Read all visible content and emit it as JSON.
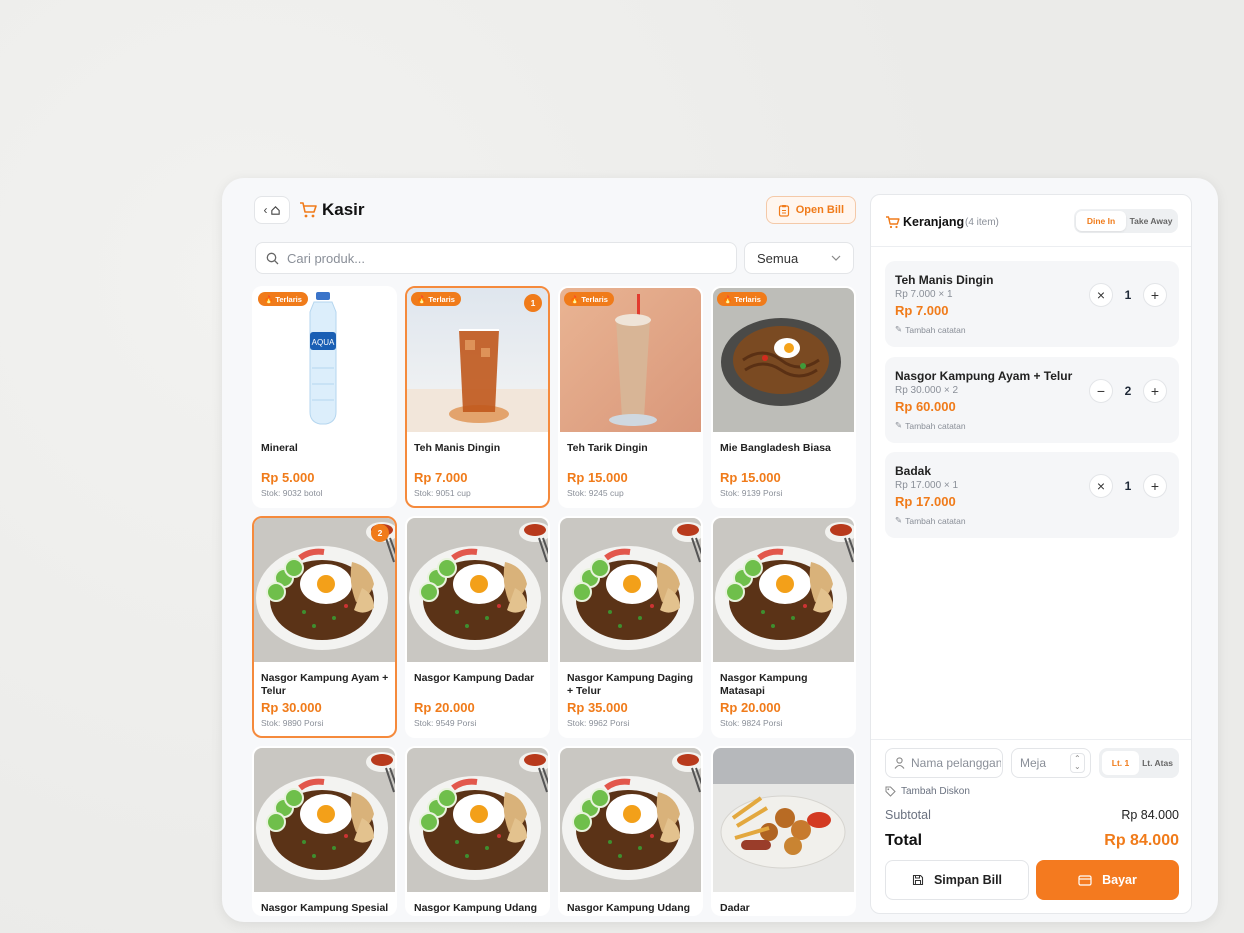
{
  "header": {
    "title": "Kasir",
    "open_bill": "Open Bill"
  },
  "search": {
    "placeholder": "Cari produk...",
    "filter_value": "Semua"
  },
  "badge_label": "Terlaris",
  "products": [
    {
      "name": "Mineral",
      "price": "Rp 5.000",
      "stock": "Stok: 9032 botol",
      "badge": true,
      "qty": "",
      "image": "water-bottle"
    },
    {
      "name": "Teh Manis Dingin",
      "price": "Rp 7.000",
      "stock": "Stok: 9051 cup",
      "badge": true,
      "qty": "1",
      "image": "iced-tea"
    },
    {
      "name": "Teh Tarik Dingin",
      "price": "Rp 15.000",
      "stock": "Stok: 9245 cup",
      "badge": true,
      "qty": "",
      "image": "teh-tarik"
    },
    {
      "name": "Mie Bangladesh Biasa",
      "price": "Rp 15.000",
      "stock": "Stok: 9139 Porsi",
      "badge": true,
      "qty": "",
      "image": "noodles"
    },
    {
      "name": "Nasgor Kampung Ayam + Telur",
      "price": "Rp 30.000",
      "stock": "Stok: 9890 Porsi",
      "badge": false,
      "qty": "2",
      "image": "fried-rice"
    },
    {
      "name": "Nasgor Kampung Dadar",
      "price": "Rp 20.000",
      "stock": "Stok: 9549 Porsi",
      "badge": false,
      "qty": "",
      "image": "fried-rice"
    },
    {
      "name": "Nasgor Kampung Daging + Telur",
      "price": "Rp 35.000",
      "stock": "Stok: 9962 Porsi",
      "badge": false,
      "qty": "",
      "image": "fried-rice"
    },
    {
      "name": "Nasgor Kampung Matasapi",
      "price": "Rp 20.000",
      "stock": "Stok: 9824 Porsi",
      "badge": false,
      "qty": "",
      "image": "fried-rice"
    },
    {
      "name": "Nasgor Kampung Spesial",
      "price": "",
      "stock": "",
      "badge": false,
      "qty": "",
      "image": "fried-rice"
    },
    {
      "name": "Nasgor Kampung Udang +",
      "price": "",
      "stock": "",
      "badge": false,
      "qty": "",
      "image": "fried-rice"
    },
    {
      "name": "Nasgor Kampung Udang +",
      "price": "",
      "stock": "",
      "badge": false,
      "qty": "",
      "image": "fried-rice"
    },
    {
      "name": "Dadar",
      "price": "",
      "stock": "",
      "badge": false,
      "qty": "",
      "image": "fried-snacks"
    }
  ],
  "cart": {
    "title": "Keranjang",
    "count": "(4 item)",
    "mode_options": [
      "Dine In",
      "Take Away"
    ],
    "mode_selected": "Dine In",
    "items": [
      {
        "name": "Teh Manis Dingin",
        "unit": "Rp 7.000 × 1",
        "total": "Rp 7.000",
        "qty": "1",
        "note": "Tambah catatan",
        "minus": "×"
      },
      {
        "name": "Nasgor Kampung Ayam + Telur",
        "unit": "Rp 30.000 × 2",
        "total": "Rp 60.000",
        "qty": "2",
        "note": "Tambah catatan",
        "minus": "−"
      },
      {
        "name": "Badak",
        "unit": "Rp 17.000 × 1",
        "total": "Rp 17.000",
        "qty": "1",
        "note": "Tambah catatan",
        "minus": "×"
      }
    ]
  },
  "footer": {
    "customer_placeholder": "Nama pelanggan",
    "table_placeholder": "Meja",
    "floor_options": [
      "Lt. 1",
      "Lt. Atas"
    ],
    "discount": "Tambah Diskon",
    "subtotal_label": "Subtotal",
    "subtotal_value": "Rp 84.000",
    "total_label": "Total",
    "total_value": "Rp 84.000",
    "save_label": "Simpan Bill",
    "pay_label": "Bayar"
  },
  "colors": {
    "accent": "#f07b1a",
    "background": "#eeeeec"
  }
}
